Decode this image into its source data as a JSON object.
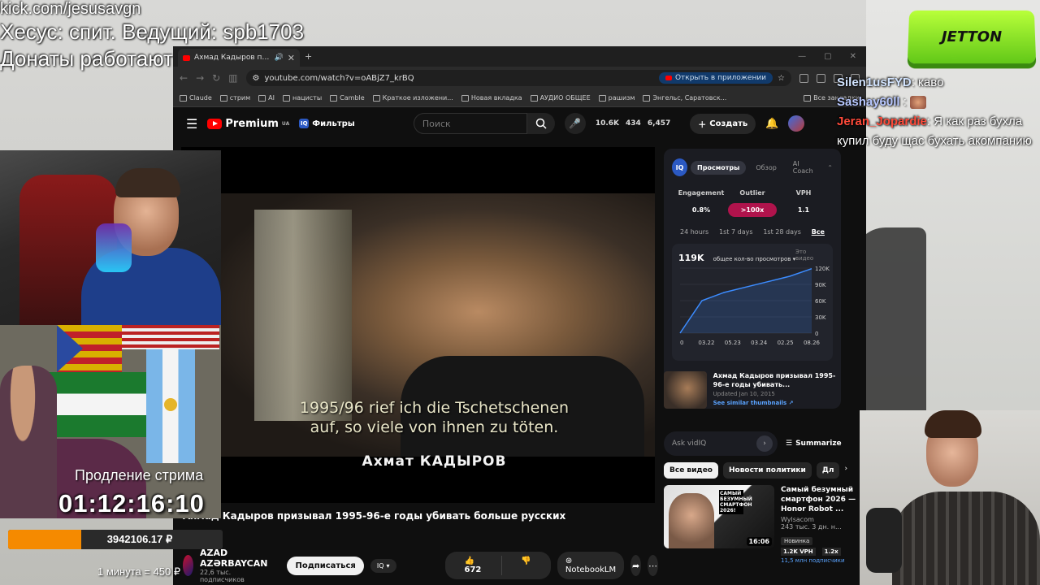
{
  "stream_overlay": {
    "url_line": "kick.com/jesusavgn",
    "info_line": "Хесус: спит. Ведущий: spb1703",
    "donate_line": "Донаты работают",
    "extension_label": "Продление стрима",
    "timer": "01:12:16:10",
    "donation_total": "3942106.17 ₽",
    "donation_progress_pct": 34,
    "rate_text": "1 минута = 450 ₽",
    "logo_text": "JETTON"
  },
  "chat": {
    "messages": [
      {
        "nick": "Silen1usFYD",
        "text": ": каво"
      },
      {
        "nick": "Sashay60ll",
        "text": " :"
      },
      {
        "nick": "Jeran_Jopardie",
        "text": ": Я как раз бухла купил буду щас бухать акомпанию"
      }
    ]
  },
  "browser": {
    "tab_title": "Ахмад Кадыров призывал",
    "url": "youtube.com/watch?v=oABjZ7_krBQ",
    "open_in_app": "Открыть в приложении",
    "bookmarks": [
      "Claude",
      "стрим",
      "AI",
      "нацисты",
      "Camble",
      "Краткое изложени...",
      "Новая вкладка",
      "АУДИО ОБЩЕЕ",
      "рашизм",
      "Энгельс, Саратовск...",
      "Все закладки"
    ]
  },
  "youtube": {
    "logo": "Premium",
    "region": "UA",
    "filters_label": "Фильтры",
    "search_placeholder": "Поиск",
    "stats": [
      "10.6K",
      "434",
      "6,457"
    ],
    "create_label": "Создать",
    "video": {
      "subtitle_line1": "1995/96 rief ich die Tschetschenen",
      "subtitle_line2": "auf, so viele von ihnen zu töten.",
      "caption_name": "Ахмат КАДЫРОВ",
      "title": "Ахмад Кадыров призывал 1995-96-е годы убивать больше русских"
    },
    "channel": {
      "name": "AZAD AZƏRBAYCAN",
      "subs": "22,6 тыс. подписчиков",
      "subscribe_label": "Подписаться",
      "likes": "672",
      "notebook_label": "NotebookLM"
    }
  },
  "vidiq": {
    "tabs": [
      "Просмотры",
      "Обзор",
      "AI Coach"
    ],
    "metrics": [
      {
        "label": "Engagement",
        "value": "0.8%"
      },
      {
        "label": "Outlier",
        "value": ">100x"
      },
      {
        "label": "VPH",
        "value": "1.1"
      }
    ],
    "ranges": [
      "24 hours",
      "1st 7 days",
      "1st 28 days",
      "Все"
    ],
    "views_count": "119K",
    "views_dropdown": "общее кол-во просмотров",
    "this_video": "Это видео",
    "card_title": "Ахмад Кадыров призывал 1995-96-е годы убивать...",
    "card_updated": "Updated Jan 10, 2015",
    "card_link": "See similar thumbnails ↗",
    "ask_placeholder": "Ask vidIQ",
    "summarize_label": "Summarize"
  },
  "chart_data": {
    "type": "line",
    "x": [
      "0",
      "03.22",
      "05.23",
      "03.24",
      "02.25",
      "08.26"
    ],
    "y_ticks": [
      "120K",
      "90K",
      "60K",
      "30K",
      "0"
    ],
    "ylim": [
      0,
      120000
    ],
    "series": [
      {
        "values": [
          0,
          60000,
          75000,
          85000,
          95000,
          105000,
          119000
        ]
      }
    ]
  },
  "recommendations": {
    "chips": [
      "Все видео",
      "Новости политики",
      "Дл"
    ],
    "items": [
      {
        "title": "Самый безумный смартфон 2026 — Honor Robot ...",
        "channel": "Wylsacom",
        "meta": "243 тыс. 3 дн. н...",
        "duration": "16:06",
        "badge": "Новинка",
        "vph": "1.2K VPH",
        "ratio": "1.2x",
        "subs": "11,5 млн подписчики",
        "thumb_text": "САМЫЙ БЕЗУМНЫЙ СМАРТФОН 2026!"
      }
    ]
  }
}
